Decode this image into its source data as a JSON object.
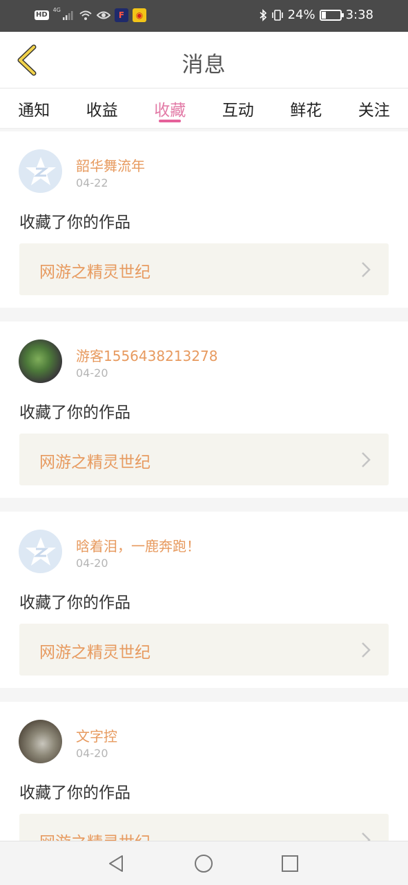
{
  "status_bar": {
    "hd": "HD",
    "network": "4G",
    "battery_text": "24%",
    "battery_level": 0.24,
    "time": "3:38",
    "icons": [
      "signal-icon",
      "wifi-icon",
      "eye-icon",
      "bluetooth-icon",
      "vibrate-icon",
      "battery-icon"
    ]
  },
  "header": {
    "title": "消息",
    "back_icon": "chevron-left-icon"
  },
  "tabs": [
    {
      "label": "通知",
      "active": false
    },
    {
      "label": "收益",
      "active": false
    },
    {
      "label": "收藏",
      "active": true
    },
    {
      "label": "互动",
      "active": false
    },
    {
      "label": "鲜花",
      "active": false
    },
    {
      "label": "关注",
      "active": false
    }
  ],
  "items": [
    {
      "username": "韶华舞流年",
      "date": "04-22",
      "action": "收藏了你的作品",
      "work": "网游之精灵世纪",
      "avatar": "default-avatar"
    },
    {
      "username": "游客1556438213278",
      "date": "04-20",
      "action": "收藏了你的作品",
      "work": "网游之精灵世纪",
      "avatar": "photo-avatar"
    },
    {
      "username": "晗着泪，一鹿奔跑！",
      "date": "04-20",
      "action": "收藏了你的作品",
      "work": "网游之精灵世纪",
      "avatar": "default-avatar"
    },
    {
      "username": "文字控",
      "date": "04-20",
      "action": "收藏了你的作品",
      "work": "网游之精灵世纪",
      "avatar": "photo-avatar"
    }
  ],
  "colors": {
    "accent_pink": "#e5619a",
    "username_orange": "#e79a5f",
    "back_yellow": "#f1d24b",
    "status_bar_bg": "#4a4a4a"
  },
  "nav": {
    "back_icon": "triangle-back-icon",
    "home_icon": "circle-home-icon",
    "recents_icon": "square-recents-icon"
  }
}
